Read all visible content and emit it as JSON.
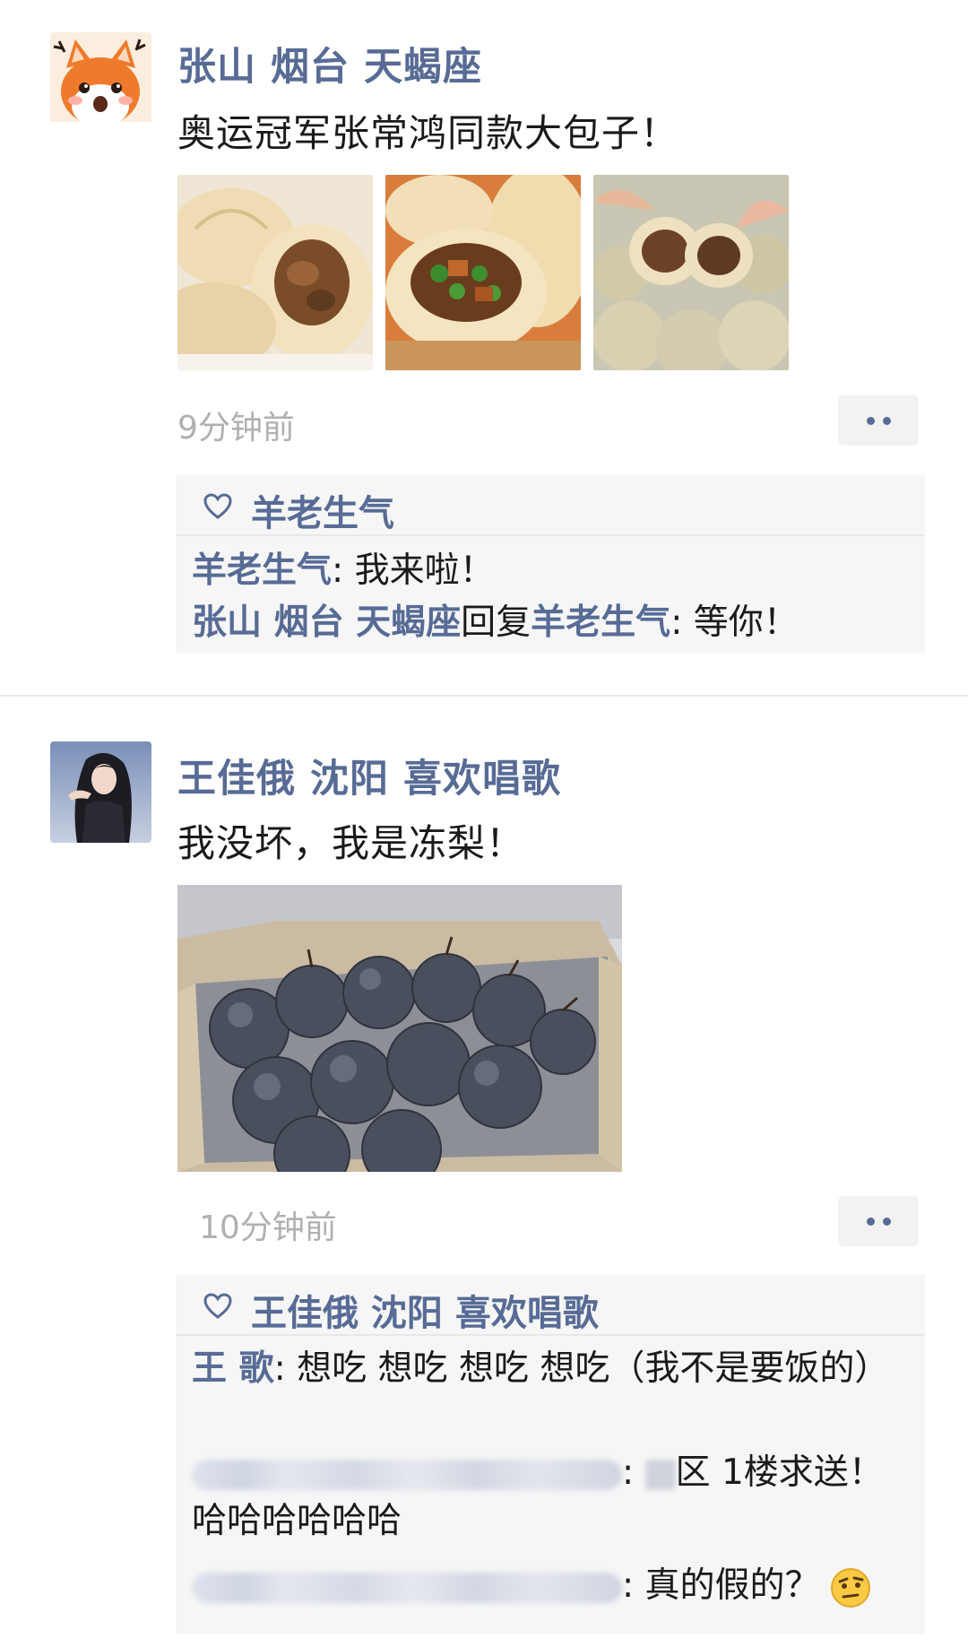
{
  "posts": [
    {
      "author": "张山  烟台 天蝎座",
      "text": "奥运冠军张常鸿同款大包子！",
      "time": "9分钟前",
      "likes": "羊老生气",
      "comments": [
        {
          "name": "羊老生气",
          "sep": ": ",
          "text": "我来啦！"
        },
        {
          "name": "张山  烟台 天蝎座",
          "reply_word": "回复",
          "reply_to": "羊老生气",
          "sep": ": ",
          "text": "等你！"
        }
      ]
    },
    {
      "author": "王佳俄 沈阳 喜欢唱歌",
      "text": "我没坏，我是冻梨！",
      "time": "10分钟前",
      "likes": "王佳俄 沈阳 喜欢唱歌",
      "comments": [
        {
          "name": "王 歌",
          "sep": ": ",
          "text": "想吃   想吃   想吃    想吃（我不是要饭的）"
        },
        {
          "sep": ": ",
          "text": "区 1楼求送！哈哈哈哈哈哈"
        },
        {
          "sep": ": ",
          "text": "真的假的？"
        }
      ]
    }
  ],
  "icons": {
    "avatar_1": "cartoon-fox-avatar",
    "avatar_2": "woman-portrait-avatar",
    "like": "heart-outline-icon",
    "more": "two-dots-more-icon",
    "emoji": "raised-eyebrow-emoji"
  },
  "colors": {
    "name": "#576b95",
    "text": "#1a1a1a",
    "time": "#b0b0b0",
    "panel": "#f6f6f6"
  }
}
